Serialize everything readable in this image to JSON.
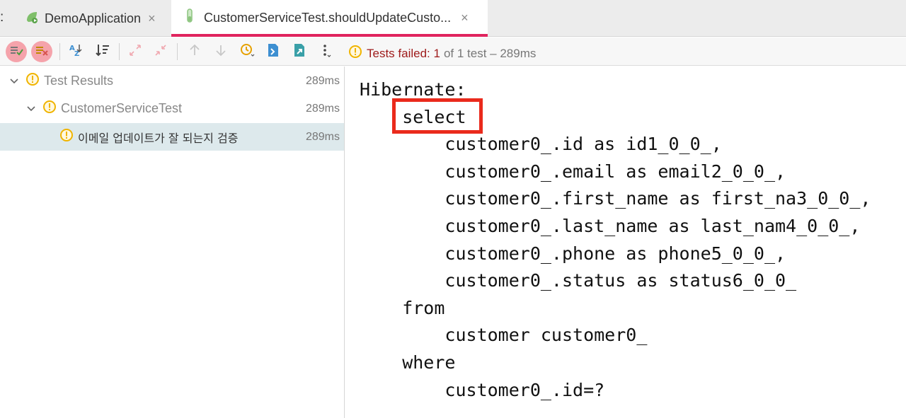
{
  "tabs": {
    "prefix": ":",
    "demo": {
      "label": "DemoApplication",
      "close": "×"
    },
    "test": {
      "label": "CustomerServiceTest.shouldUpdateCusto...",
      "close": "×"
    }
  },
  "toolbar": {
    "status_failed": "Tests failed: 1",
    "status_rest": "of 1 test – 289ms"
  },
  "tree": {
    "root": {
      "label": "Test Results",
      "time": "289ms"
    },
    "suite": {
      "label": "CustomerServiceTest",
      "time": "289ms"
    },
    "test": {
      "label": "이메일 업데이트가 잘 되는지 검증",
      "time": "289ms"
    }
  },
  "console": {
    "lines": [
      "Hibernate:",
      "    select",
      "        customer0_.id as id1_0_0_,",
      "        customer0_.email as email2_0_0_,",
      "        customer0_.first_name as first_na3_0_0_,",
      "        customer0_.last_name as last_nam4_0_0_,",
      "        customer0_.phone as phone5_0_0_,",
      "        customer0_.status as status6_0_0_",
      "    from",
      "        customer customer0_",
      "    where",
      "        customer0_.id=?"
    ]
  },
  "colors": {
    "accent_tab": "#e0245e",
    "highlight": "#ea2a1c",
    "warning": "#f0b400",
    "failed_text": "#9e1a1a",
    "selected_row": "#dde9ec"
  }
}
